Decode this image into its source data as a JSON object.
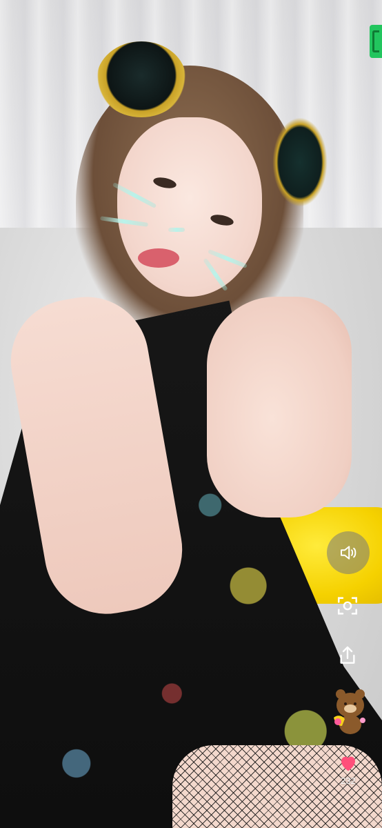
{
  "live": {
    "like_count": "232"
  },
  "controls": {
    "sound_icon": "speaker-volume-icon",
    "screenshot_icon": "screenshot-frame-icon",
    "share_icon": "share-upload-icon",
    "like_icon": "heart-icon"
  },
  "colors": {
    "brand_green": "#22c55e",
    "heart_pink": "#ff4f7a",
    "control_bg": "rgba(120,120,120,0.55)"
  }
}
